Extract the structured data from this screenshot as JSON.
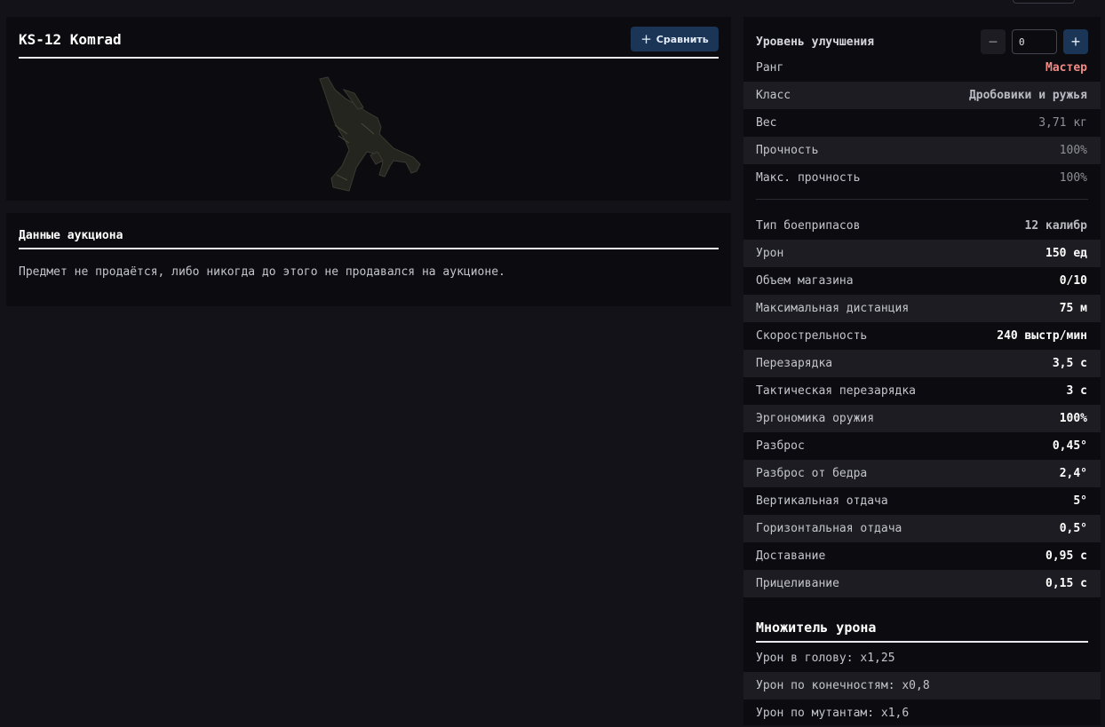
{
  "item": {
    "title": "KS-12 Komrad",
    "compare_label": "Сравнить"
  },
  "auction": {
    "title": "Данные аукциона",
    "message": "Предмет не продаётся, либо никогда до этого не продавался на аукционе."
  },
  "upgrade": {
    "label": "Уровень улучшения",
    "value": "0",
    "minus": "−",
    "plus": "+"
  },
  "stats_basic": [
    {
      "label": "Ранг",
      "value": "Мастер"
    },
    {
      "label": "Класс",
      "value": "Дробовики и ружья"
    },
    {
      "label": "Вес",
      "value": "3,71 кг"
    },
    {
      "label": "Прочность",
      "value": "100%"
    },
    {
      "label": "Макс. прочность",
      "value": "100%"
    }
  ],
  "stats_weapon": [
    {
      "label": "Тип боеприпасов",
      "value": "12 калибр"
    },
    {
      "label": "Урон",
      "value": "150 ед"
    },
    {
      "label": "Объем магазина",
      "value": "0/10"
    },
    {
      "label": "Максимальная дистанция",
      "value": "75 м"
    },
    {
      "label": "Скорострельность",
      "value": "240 выстр/мин"
    },
    {
      "label": "Перезарядка",
      "value": "3,5 с"
    },
    {
      "label": "Тактическая перезарядка",
      "value": "3 с"
    },
    {
      "label": "Эргономика оружия",
      "value": "100%"
    },
    {
      "label": "Разброс",
      "value": "0,45°"
    },
    {
      "label": "Разброс от бедра",
      "value": "2,4°"
    },
    {
      "label": "Вертикальная отдача",
      "value": "5°"
    },
    {
      "label": "Горизонтальная отдача",
      "value": "0,5°"
    },
    {
      "label": "Доставание",
      "value": "0,95 с"
    },
    {
      "label": "Прицеливание",
      "value": "0,15 с"
    }
  ],
  "multiplier": {
    "title": "Множитель урона",
    "items": [
      "Урон в голову: x1,25",
      "Урон по конечностям: x0,8",
      "Урон по мутантам: x1,6"
    ]
  },
  "colors": {
    "rank": "#f08b86",
    "accent": "#1b3556"
  }
}
